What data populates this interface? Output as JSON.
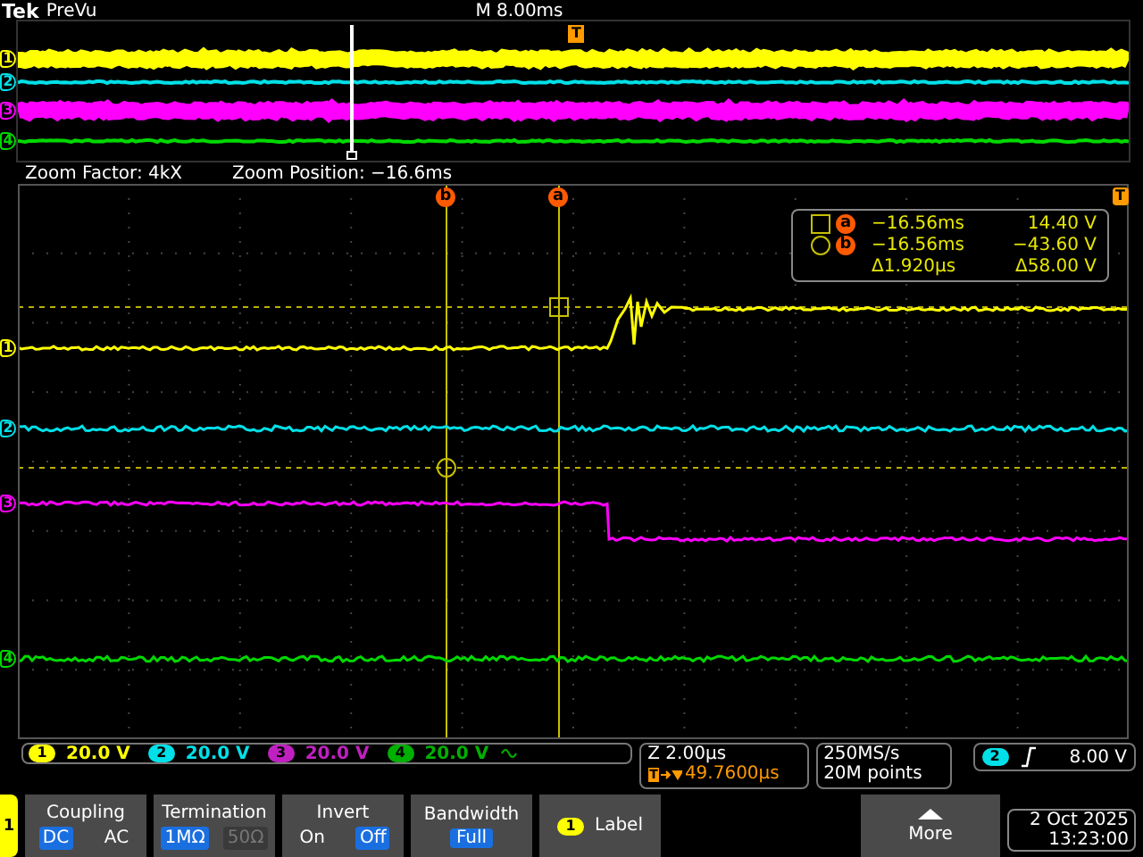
{
  "header": {
    "brand": "Tek",
    "mode": "PreVu",
    "timebase": "M 8.00ms"
  },
  "channels": [
    {
      "label": "1",
      "color": "#ffff00"
    },
    {
      "label": "2",
      "color": "#00e0e8"
    },
    {
      "label": "3",
      "color": "#ff00ff"
    },
    {
      "label": "4",
      "color": "#00d800"
    }
  ],
  "overview": {
    "trigger_marker": "T",
    "markers": [
      {
        "label": "1",
        "color": "#ffff00"
      },
      {
        "label": "2",
        "color": "#00e0e8"
      },
      {
        "label": "3",
        "color": "#ff00ff"
      },
      {
        "label": "4",
        "color": "#00d800"
      }
    ]
  },
  "zoom": {
    "factor": "Zoom Factor: 4kX",
    "position": "Zoom Position: −16.6ms"
  },
  "cursors": [
    {
      "label": "b"
    },
    {
      "label": "a"
    }
  ],
  "trigger_marker": "T",
  "readout": {
    "rows": [
      {
        "kind": "square",
        "marker": "a",
        "time": "−16.56ms",
        "value": "14.40 V"
      },
      {
        "kind": "circle",
        "marker": "b",
        "time": "−16.56ms",
        "value": "−43.60 V"
      }
    ],
    "delta_time": "Δ1.920µs",
    "delta_value": "Δ58.00 V"
  },
  "status": {
    "channels": [
      {
        "label": "1",
        "scale": "20.0 V",
        "color": "#ffff00",
        "bandwidth_limited": false
      },
      {
        "label": "2",
        "scale": "20.0 V",
        "color": "#00e0e8",
        "bandwidth_limited": false
      },
      {
        "label": "3",
        "scale": "20.0 V",
        "color": "#c020c0",
        "bandwidth_limited": false
      },
      {
        "label": "4",
        "scale": "20.0 V",
        "color": "#00b000",
        "bandwidth_limited": true
      }
    ],
    "horizontal": {
      "scale": "Z 2.00µs",
      "trigger_marker": "T",
      "trigger_position": "49.7600µs"
    },
    "acquisition": {
      "rate": "250MS/s",
      "record": "20M points"
    },
    "trigger": {
      "source": "2",
      "threshold": "8.00 V"
    }
  },
  "menu": {
    "channel": "1",
    "items": [
      {
        "kind": "toggle",
        "title": "Coupling",
        "options": [
          {
            "label": "DC",
            "selected": true,
            "disabled": false
          },
          {
            "label": "AC",
            "selected": false,
            "disabled": false
          }
        ]
      },
      {
        "kind": "toggle",
        "title": "Termination",
        "options": [
          {
            "label": "1MΩ",
            "selected": true,
            "disabled": false
          },
          {
            "label": "50Ω",
            "selected": false,
            "disabled": true
          }
        ]
      },
      {
        "kind": "toggle",
        "title": "Invert",
        "options": [
          {
            "label": "On",
            "selected": false,
            "disabled": false
          },
          {
            "label": "Off",
            "selected": true,
            "disabled": false
          }
        ]
      },
      {
        "kind": "value",
        "title": "Bandwidth",
        "value": "Full",
        "selected": true
      },
      {
        "kind": "label",
        "title": "Label",
        "channel": "1"
      },
      {
        "kind": "more",
        "title": "More"
      }
    ]
  },
  "clock": {
    "date": "2 Oct  2025",
    "time": "13:23:00"
  }
}
